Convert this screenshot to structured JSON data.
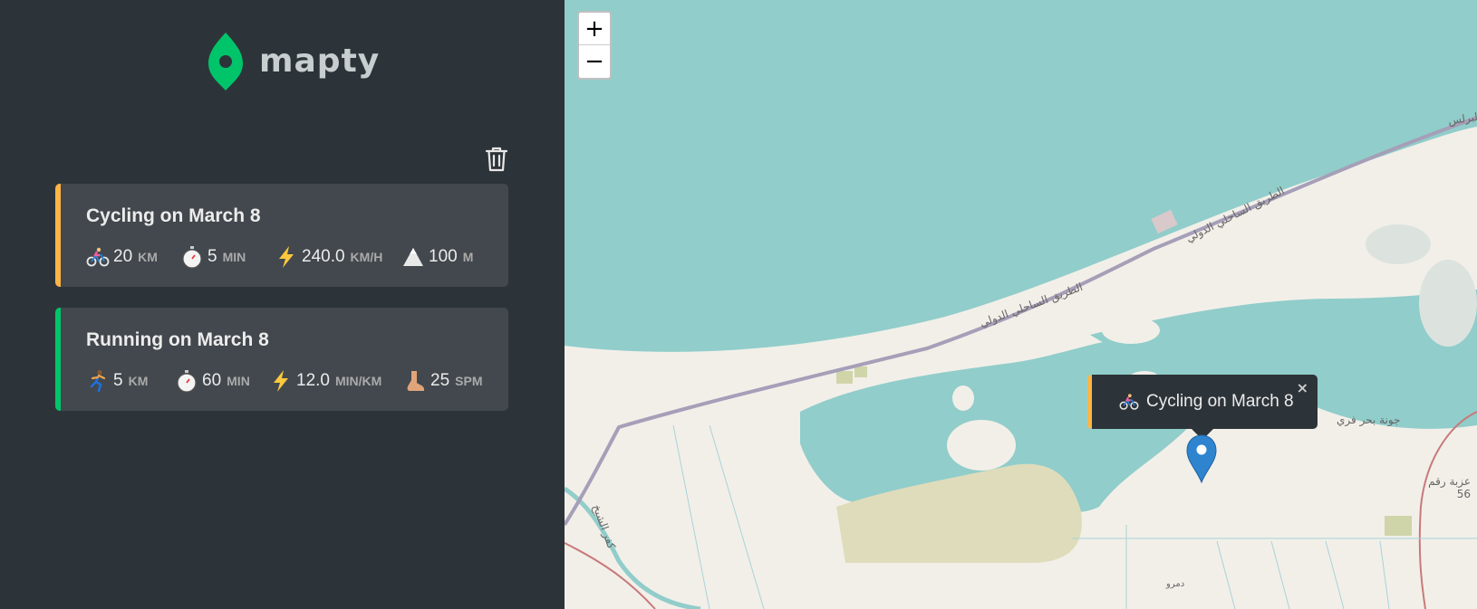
{
  "app": {
    "name": "mapty"
  },
  "colors": {
    "cycling": "#ffb545",
    "running": "#00c46a",
    "sidebar": "#2d3439",
    "card": "#42484d",
    "water": "#91cdca",
    "land": "#f2efe9"
  },
  "toolbar": {
    "delete_all_icon": "trash-icon"
  },
  "workouts": [
    {
      "type": "cycling",
      "title": "Cycling on March 8",
      "details": [
        {
          "icon": "cyclist-emoji",
          "value": "20",
          "unit": "km"
        },
        {
          "icon": "stopwatch-emoji",
          "value": "5",
          "unit": "min"
        },
        {
          "icon": "lightning-emoji",
          "value": "240.0",
          "unit": "km/h"
        },
        {
          "icon": "mountain-emoji",
          "value": "100",
          "unit": "m"
        }
      ]
    },
    {
      "type": "running",
      "title": "Running on March 8",
      "details": [
        {
          "icon": "runner-emoji",
          "value": "5",
          "unit": "km"
        },
        {
          "icon": "stopwatch-emoji",
          "value": "60",
          "unit": "min"
        },
        {
          "icon": "lightning-emoji",
          "value": "12.0",
          "unit": "min/km"
        },
        {
          "icon": "footprint-emoji",
          "value": "25",
          "unit": "spm"
        }
      ]
    }
  ],
  "map": {
    "zoom_in": "+",
    "zoom_out": "−",
    "popup": {
      "text": "Cycling on March 8",
      "close": "×",
      "icon": "cyclist-emoji"
    },
    "labels": {
      "road_1": "الطريق الساحلي الدولي",
      "road_2": "الطريق الساحلي الدولي",
      "top_right": "البرلس",
      "bay": "جونة بحر فري",
      "village": "عزبة رقم 56",
      "left_river": "كفر الشيخ",
      "bottom": "دمرو"
    }
  }
}
